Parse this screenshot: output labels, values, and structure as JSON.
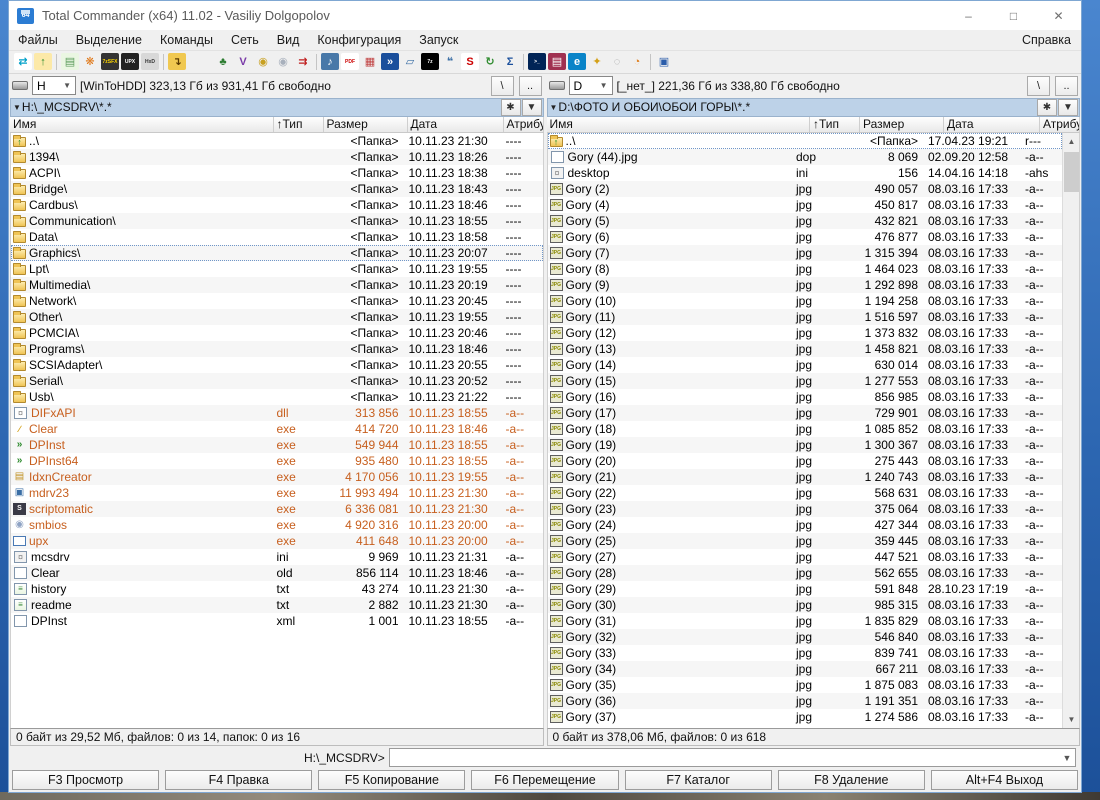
{
  "window": {
    "title": "Total Commander (x64) 11.02 - Vasiliy Dolgopolov",
    "controls": {
      "minimize": "–",
      "maximize": "□",
      "close": "✕"
    }
  },
  "colors": {
    "path_bar": "#bdd2e8",
    "exe_file_text": "#c75f1e",
    "desktop_blue": "#2d67b2",
    "app_icon_blue": "#2b7cd3"
  },
  "menu": {
    "items": [
      "Файлы",
      "Выделение",
      "Команды",
      "Сеть",
      "Вид",
      "Конфигурация",
      "Запуск"
    ],
    "right_item": "Справка"
  },
  "toolbar": [
    {
      "n": "swap-panels-icon",
      "g": "⇄",
      "c": "#00a0c8",
      "b": "#ffffff"
    },
    {
      "n": "folder-up-icon",
      "g": "↑",
      "c": "#2e8b2e",
      "b": "#fce9a8"
    },
    "sep",
    {
      "n": "notes-icon",
      "g": "▤",
      "c": "#5a9a5a",
      "b": "#eaf6e2"
    },
    {
      "n": "7zip-flower-icon",
      "g": "❋",
      "c": "#e07818",
      "b": "#f0f0f0"
    },
    {
      "n": "7z-sfx-icon",
      "g": "7zSFX",
      "c": "#ffd700",
      "b": "#333333",
      "t": 1
    },
    {
      "n": "upx-shell-icon",
      "g": "UPX",
      "c": "#ffffff",
      "b": "#222222",
      "t": 1
    },
    {
      "n": "hxd-icon",
      "g": "HxD",
      "c": "#333333",
      "b": "#d8d8d8",
      "t": 1
    },
    "sep",
    {
      "n": "tc-utility-icon",
      "g": "↴",
      "c": "#5a3a00",
      "b": "#f0c850"
    },
    "gap",
    {
      "n": "tree-icon",
      "g": "♣",
      "c": "#2e7d32",
      "b": "#f0f0f0"
    },
    {
      "n": "verify-icon",
      "g": "V",
      "c": "#7a3aa8",
      "b": "#f0f0f0"
    },
    {
      "n": "cd-gold-icon",
      "g": "◉",
      "c": "#c8a020",
      "b": "#f0f0f0"
    },
    {
      "n": "cd-silver-icon",
      "g": "◉",
      "c": "#a8b0bc",
      "b": "#f0f0f0"
    },
    {
      "n": "compare-icon",
      "g": "⇉",
      "c": "#c02020",
      "b": "#f0f0f0"
    },
    "sep",
    {
      "n": "mp3-icon",
      "g": "♪",
      "c": "#ffffff",
      "b": "#4878a8"
    },
    {
      "n": "pdf-icon",
      "g": "PDF",
      "c": "#cc0000",
      "b": "#ffffff",
      "t": 1
    },
    {
      "n": "image-tool-icon",
      "g": "▦",
      "c": "#c04040",
      "b": "#f0f0f0"
    },
    {
      "n": "blue-arrows-icon",
      "g": "»",
      "c": "#ffffff",
      "b": "#1a4f9c"
    },
    {
      "n": "zip-folder-icon",
      "g": "▱",
      "c": "#3a6ea5",
      "b": "#f0f0f0"
    },
    {
      "n": "7zip-icon",
      "g": "7z",
      "c": "#ffffff",
      "b": "#000000",
      "t": 1
    },
    {
      "n": "speech-icon",
      "g": "❝",
      "c": "#3a6ea5",
      "b": "#f0f0f0"
    },
    {
      "n": "scriptomatic-icon",
      "g": "S",
      "c": "#cc0000",
      "b": "#ffffff"
    },
    {
      "n": "sync-icon",
      "g": "↻",
      "c": "#2e8b2e",
      "b": "#f0f0f0"
    },
    {
      "n": "sigma-icon",
      "g": "Σ",
      "c": "#1a4f9c",
      "b": "#f0f0f0"
    },
    "sep",
    {
      "n": "powershell-icon",
      "g": ">_",
      "c": "#ffffff",
      "b": "#012456",
      "t": 1
    },
    {
      "n": "winrar-icon",
      "g": "▤",
      "c": "#ffffff",
      "b": "#a03050"
    },
    {
      "n": "edge-icon",
      "g": "e",
      "c": "#ffffff",
      "b": "#0a84c8"
    },
    {
      "n": "key-icon",
      "g": "✦",
      "c": "#d4a017",
      "b": "#f0f0f0"
    },
    {
      "n": "globe-icon",
      "g": "◌",
      "c": "#999999",
      "b": "#f0f0f0"
    },
    {
      "n": "browser-icon",
      "g": "◔",
      "c": "#e08020",
      "b": "#f0f0f0"
    },
    "sep",
    {
      "n": "monitor-check-icon",
      "g": "▣",
      "c": "#2a5caa",
      "b": "#f0f0f0"
    }
  ],
  "panel_buttons": {
    "root": "\\",
    "parent": "..",
    "star": "✱",
    "history": "▼"
  },
  "headers": [
    "Имя",
    "↑Тип",
    "Размер",
    "Дата",
    "Атрибу"
  ],
  "icon_glyphs": {
    "up": "↑",
    "folder": "",
    "page": "",
    "note": "≡",
    "gear": "¤",
    "gearpage": "¤",
    "jpg": "JPG",
    "broom": "∕",
    "dparrow": "»",
    "db": "▤",
    "monitor": "▣",
    "sbox": "S",
    "cd": "◉",
    "box": ""
  },
  "left_panel": {
    "drive": {
      "letter": "H",
      "info": "[WinToHDD]  323,13 Гб из 931,41 Гб свободно"
    },
    "path": "H:\\_MCSDRV\\*.*",
    "status": "0 байт из 29,52 Мб, файлов: 0 из 14, папок: 0 из 16",
    "rows": [
      [
        "up",
        "..\\",
        "",
        "<Папка>",
        "10.11.23 21:30",
        "----",
        ""
      ],
      [
        "folder",
        "1394\\",
        "",
        "<Папка>",
        "10.11.23 18:26",
        "----",
        ""
      ],
      [
        "folder",
        "ACPI\\",
        "",
        "<Папка>",
        "10.11.23 18:38",
        "----",
        ""
      ],
      [
        "folder",
        "Bridge\\",
        "",
        "<Папка>",
        "10.11.23 18:43",
        "----",
        ""
      ],
      [
        "folder",
        "Cardbus\\",
        "",
        "<Папка>",
        "10.11.23 18:46",
        "----",
        ""
      ],
      [
        "folder",
        "Communication\\",
        "",
        "<Папка>",
        "10.11.23 18:55",
        "----",
        ""
      ],
      [
        "folder",
        "Data\\",
        "",
        "<Папка>",
        "10.11.23 18:58",
        "----",
        ""
      ],
      [
        "folder",
        "Graphics\\",
        "",
        "<Папка>",
        "10.11.23 20:07",
        "----",
        "cursor"
      ],
      [
        "folder",
        "Lpt\\",
        "",
        "<Папка>",
        "10.11.23 19:55",
        "----",
        ""
      ],
      [
        "folder",
        "Multimedia\\",
        "",
        "<Папка>",
        "10.11.23 20:19",
        "----",
        ""
      ],
      [
        "folder",
        "Network\\",
        "",
        "<Папка>",
        "10.11.23 20:45",
        "----",
        ""
      ],
      [
        "folder",
        "Other\\",
        "",
        "<Папка>",
        "10.11.23 19:55",
        "----",
        ""
      ],
      [
        "folder",
        "PCMCIA\\",
        "",
        "<Папка>",
        "10.11.23 20:46",
        "----",
        ""
      ],
      [
        "folder",
        "Programs\\",
        "",
        "<Папка>",
        "10.11.23 18:46",
        "----",
        ""
      ],
      [
        "folder",
        "SCSIAdapter\\",
        "",
        "<Папка>",
        "10.11.23 20:55",
        "----",
        ""
      ],
      [
        "folder",
        "Serial\\",
        "",
        "<Папка>",
        "10.11.23 20:52",
        "----",
        ""
      ],
      [
        "folder",
        "Usb\\",
        "",
        "<Папка>",
        "10.11.23 21:22",
        "----",
        ""
      ],
      [
        "gearpage",
        "DIFxAPI",
        "dll",
        "313 856",
        "10.11.23 18:55",
        "-a--",
        "exe"
      ],
      [
        "broom",
        "Clear",
        "exe",
        "414 720",
        "10.11.23 18:46",
        "-a--",
        "exe"
      ],
      [
        "dparrow",
        "DPInst",
        "exe",
        "549 944",
        "10.11.23 18:55",
        "-a--",
        "exe"
      ],
      [
        "dparrow",
        "DPInst64",
        "exe",
        "935 480",
        "10.11.23 18:55",
        "-a--",
        "exe"
      ],
      [
        "db",
        "IdxnCreator",
        "exe",
        "4 170 056",
        "10.11.23 19:55",
        "-a--",
        "exe"
      ],
      [
        "monitor",
        "mdrv23",
        "exe",
        "11 993 494",
        "10.11.23 21:30",
        "-a--",
        "exe"
      ],
      [
        "sbox",
        "scriptomatic",
        "exe",
        "6 336 081",
        "10.11.23 21:30",
        "-a--",
        "exe"
      ],
      [
        "cd",
        "smbios",
        "exe",
        "4 920 316",
        "10.11.23 20:00",
        "-a--",
        "exe"
      ],
      [
        "box",
        "upx",
        "exe",
        "411 648",
        "10.11.23 20:00",
        "-a--",
        "exe"
      ],
      [
        "gear",
        "mcsdrv",
        "ini",
        "9 969",
        "10.11.23 21:31",
        "-a--",
        ""
      ],
      [
        "page",
        "Clear",
        "old",
        "856 114",
        "10.11.23 18:46",
        "-a--",
        ""
      ],
      [
        "note",
        "history",
        "txt",
        "43 274",
        "10.11.23 21:30",
        "-a--",
        ""
      ],
      [
        "note",
        "readme",
        "txt",
        "2 882",
        "10.11.23 21:30",
        "-a--",
        ""
      ],
      [
        "page",
        "DPInst",
        "xml",
        "1 001",
        "10.11.23 18:55",
        "-a--",
        ""
      ]
    ]
  },
  "right_panel": {
    "drive": {
      "letter": "D",
      "info": "[_нет_]  221,36 Гб из 338,80 Гб свободно"
    },
    "path": "D:\\ФОТО И ОБОИ\\ОБОИ ГОРЫ\\*.*",
    "status": "0 байт из 378,06 Мб, файлов: 0 из 618",
    "has_scrollbar": true,
    "rows": [
      [
        "up",
        "..\\",
        "",
        "<Папка>",
        "17.04.23 19:21",
        "r---",
        "cursor"
      ],
      [
        "page",
        "Gory (44).jpg",
        "dop",
        "8 069",
        "02.09.20 12:58",
        "-a--",
        ""
      ],
      [
        "gear",
        "desktop",
        "ini",
        "156",
        "14.04.16 14:18",
        "-ahs",
        ""
      ],
      [
        "jpg",
        "Gory (2)",
        "jpg",
        "490 057",
        "08.03.16 17:33",
        "-a--",
        ""
      ],
      [
        "jpg",
        "Gory (4)",
        "jpg",
        "450 817",
        "08.03.16 17:33",
        "-a--",
        ""
      ],
      [
        "jpg",
        "Gory (5)",
        "jpg",
        "432 821",
        "08.03.16 17:33",
        "-a--",
        ""
      ],
      [
        "jpg",
        "Gory (6)",
        "jpg",
        "476 877",
        "08.03.16 17:33",
        "-a--",
        ""
      ],
      [
        "jpg",
        "Gory (7)",
        "jpg",
        "1 315 394",
        "08.03.16 17:33",
        "-a--",
        ""
      ],
      [
        "jpg",
        "Gory (8)",
        "jpg",
        "1 464 023",
        "08.03.16 17:33",
        "-a--",
        ""
      ],
      [
        "jpg",
        "Gory (9)",
        "jpg",
        "1 292 898",
        "08.03.16 17:33",
        "-a--",
        ""
      ],
      [
        "jpg",
        "Gory (10)",
        "jpg",
        "1 194 258",
        "08.03.16 17:33",
        "-a--",
        ""
      ],
      [
        "jpg",
        "Gory (11)",
        "jpg",
        "1 516 597",
        "08.03.16 17:33",
        "-a--",
        ""
      ],
      [
        "jpg",
        "Gory (12)",
        "jpg",
        "1 373 832",
        "08.03.16 17:33",
        "-a--",
        ""
      ],
      [
        "jpg",
        "Gory (13)",
        "jpg",
        "1 458 821",
        "08.03.16 17:33",
        "-a--",
        ""
      ],
      [
        "jpg",
        "Gory (14)",
        "jpg",
        "630 014",
        "08.03.16 17:33",
        "-a--",
        ""
      ],
      [
        "jpg",
        "Gory (15)",
        "jpg",
        "1 277 553",
        "08.03.16 17:33",
        "-a--",
        ""
      ],
      [
        "jpg",
        "Gory (16)",
        "jpg",
        "856 985",
        "08.03.16 17:33",
        "-a--",
        ""
      ],
      [
        "jpg",
        "Gory (17)",
        "jpg",
        "729 901",
        "08.03.16 17:33",
        "-a--",
        ""
      ],
      [
        "jpg",
        "Gory (18)",
        "jpg",
        "1 085 852",
        "08.03.16 17:33",
        "-a--",
        ""
      ],
      [
        "jpg",
        "Gory (19)",
        "jpg",
        "1 300 367",
        "08.03.16 17:33",
        "-a--",
        ""
      ],
      [
        "jpg",
        "Gory (20)",
        "jpg",
        "275 443",
        "08.03.16 17:33",
        "-a--",
        ""
      ],
      [
        "jpg",
        "Gory (21)",
        "jpg",
        "1 240 743",
        "08.03.16 17:33",
        "-a--",
        ""
      ],
      [
        "jpg",
        "Gory (22)",
        "jpg",
        "568 631",
        "08.03.16 17:33",
        "-a--",
        ""
      ],
      [
        "jpg",
        "Gory (23)",
        "jpg",
        "375 064",
        "08.03.16 17:33",
        "-a--",
        ""
      ],
      [
        "jpg",
        "Gory (24)",
        "jpg",
        "427 344",
        "08.03.16 17:33",
        "-a--",
        ""
      ],
      [
        "jpg",
        "Gory (25)",
        "jpg",
        "359 445",
        "08.03.16 17:33",
        "-a--",
        ""
      ],
      [
        "jpg",
        "Gory (27)",
        "jpg",
        "447 521",
        "08.03.16 17:33",
        "-a--",
        ""
      ],
      [
        "jpg",
        "Gory (28)",
        "jpg",
        "562 655",
        "08.03.16 17:33",
        "-a--",
        ""
      ],
      [
        "jpg",
        "Gory (29)",
        "jpg",
        "591 848",
        "28.10.23 17:19",
        "-a--",
        ""
      ],
      [
        "jpg",
        "Gory (30)",
        "jpg",
        "985 315",
        "08.03.16 17:33",
        "-a--",
        ""
      ],
      [
        "jpg",
        "Gory (31)",
        "jpg",
        "1 835 829",
        "08.03.16 17:33",
        "-a--",
        ""
      ],
      [
        "jpg",
        "Gory (32)",
        "jpg",
        "546 840",
        "08.03.16 17:33",
        "-a--",
        ""
      ],
      [
        "jpg",
        "Gory (33)",
        "jpg",
        "839 741",
        "08.03.16 17:33",
        "-a--",
        ""
      ],
      [
        "jpg",
        "Gory (34)",
        "jpg",
        "667 211",
        "08.03.16 17:33",
        "-a--",
        ""
      ],
      [
        "jpg",
        "Gory (35)",
        "jpg",
        "1 875 083",
        "08.03.16 17:33",
        "-a--",
        ""
      ],
      [
        "jpg",
        "Gory (36)",
        "jpg",
        "1 191 351",
        "08.03.16 17:33",
        "-a--",
        ""
      ],
      [
        "jpg",
        "Gory (37)",
        "jpg",
        "1 274 586",
        "08.03.16 17:33",
        "-a--",
        ""
      ]
    ]
  },
  "command_line": {
    "prompt": "H:\\_MCSDRV>"
  },
  "function_bar": [
    "F3 Просмотр",
    "F4 Правка",
    "F5 Копирование",
    "F6 Перемещение",
    "F7 Каталог",
    "F8 Удаление",
    "Alt+F4 Выход"
  ]
}
